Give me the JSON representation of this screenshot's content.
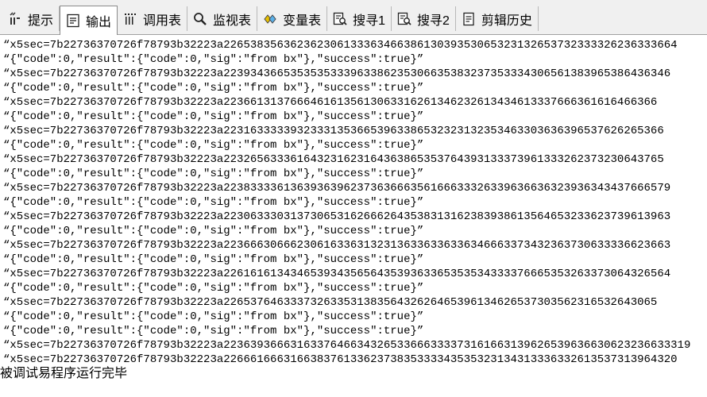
{
  "tabs": [
    {
      "label": "提示",
      "icon": "tip-icon",
      "active": false
    },
    {
      "label": "输出",
      "icon": "output-icon",
      "active": true
    },
    {
      "label": "调用表",
      "icon": "call-table-icon",
      "active": false
    },
    {
      "label": "监视表",
      "icon": "magnifier-icon",
      "active": false
    },
    {
      "label": "变量表",
      "icon": "variable-icon",
      "active": false
    },
    {
      "label": "搜寻1",
      "icon": "search-list-icon",
      "active": false
    },
    {
      "label": "搜寻2",
      "icon": "search-list-icon",
      "active": false
    },
    {
      "label": "剪辑历史",
      "icon": "clipboard-history-icon",
      "active": false
    }
  ],
  "output": {
    "lines": [
      "“x5sec=7b22736370726f78793b32223a22653835636236230613336346638613039353065323132653732333326236333664",
      "“{\"code\":0,\"result\":{\"code\":0,\"sig\":\"from bx\"},\"success\":true}”",
      "“x5sec=7b22736370726f78793b32223a2239343665353535333963386235306635383237353334306561383965386436346",
      "“{\"code\":0,\"result\":{\"code\":0,\"sig\":\"from bx\"},\"success\":true}”",
      "“x5sec=7b22736370726f78793b32223a22366131376664616135613063316261346232613434613337666361616466366",
      "“{\"code\":0,\"result\":{\"code\":0,\"sig\":\"from bx\"},\"success\":true}”",
      "“x5sec=7b22736370726f78793b32223a223163333393233313536653963386532323132353463303636396537626265366",
      "“{\"code\":0,\"result\":{\"code\":0,\"sig\":\"from bx\"},\"success\":true}”",
      "“x5sec=7b22736370726f78793b32223a223265633361643231623164363865353764393133373961333262373230643765",
      "“{\"code\":0,\"result\":{\"code\":0,\"sig\":\"from bx\"},\"success\":true}”",
      "“x5sec=7b22736370726f78793b32223a2238333361363936396237363666356166633326339636636323936343437666579",
      "“{\"code\":0,\"result\":{\"code\":0,\"sig\":\"from bx\"},\"success\":true}”",
      "“x5sec=7b22736370726f78793b32223a2230633303137306531626662643538313162383938613564653233623739613963",
      "“{\"code\":0,\"result\":{\"code\":0,\"sig\":\"from bx\"},\"success\":true}”",
      "“x5sec=7b22736370726f78793b32223a2236663066623061633631323136336336336346663373432363730633336623663",
      "“{\"code\":0,\"result\":{\"code\":0,\"sig\":\"from bx\"},\"success\":true}”",
      "“x5sec=7b22736370726f78793b32223a2261616134346539343565643539363365353534333376665353263373064326564",
      "“{\"code\":0,\"result\":{\"code\":0,\"sig\":\"from bx\"},\"success\":true}”",
      "“x5sec=7b22736370726f78793b32223a22653764633373263353138356432626465396134626537303562316532643065",
      "“{\"code\":0,\"result\":{\"code\":0,\"sig\":\"from bx\"},\"success\":true}”",
      "“{\"code\":0,\"result\":{\"code\":0,\"sig\":\"from bx\"},\"success\":true}”",
      "“x5sec=7b22736370726f78793b32223a2236393666316337646634326533666333373161663139626539636630623236633319",
      "“x5sec=7b22736370726f78793b32223a22666166631663837613362373835333343535323134313336332613537313964320"
    ],
    "status": "被调试易程序运行完毕"
  }
}
